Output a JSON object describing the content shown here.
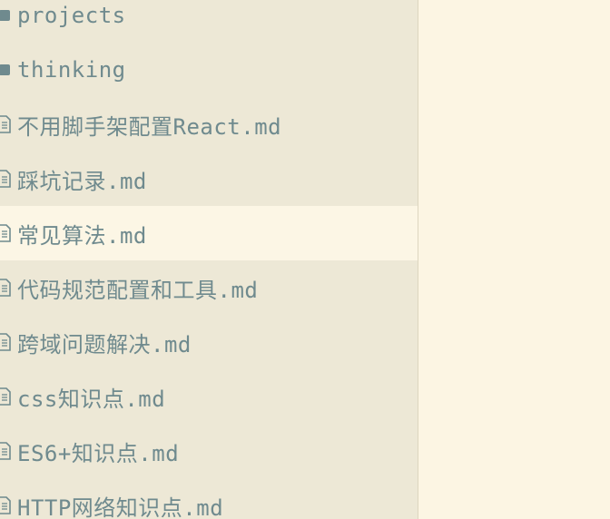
{
  "sidebar": {
    "items": [
      {
        "type": "folder",
        "label": "projects",
        "icon": "folder-icon",
        "selected": false
      },
      {
        "type": "folder",
        "label": "thinking",
        "icon": "folder-icon",
        "selected": false
      },
      {
        "type": "file",
        "label": "不用脚手架配置React.md",
        "icon": "file-icon",
        "selected": false
      },
      {
        "type": "file",
        "label": "踩坑记录.md",
        "icon": "file-icon",
        "selected": false
      },
      {
        "type": "file",
        "label": "常见算法.md",
        "icon": "file-icon",
        "selected": true
      },
      {
        "type": "file",
        "label": "代码规范配置和工具.md",
        "icon": "file-icon",
        "selected": false
      },
      {
        "type": "file",
        "label": "跨域问题解决.md",
        "icon": "file-icon",
        "selected": false
      },
      {
        "type": "file",
        "label": "css知识点.md",
        "icon": "file-icon",
        "selected": false
      },
      {
        "type": "file",
        "label": "ES6+知识点.md",
        "icon": "file-icon",
        "selected": false
      },
      {
        "type": "file",
        "label": "HTTP网络知识点.md",
        "icon": "file-icon",
        "selected": false
      }
    ]
  },
  "colors": {
    "sidebar_bg": "#ede8d6",
    "selected_bg": "#fcf6e5",
    "editor_bg": "#fcf5e3",
    "text": "#6f8a8e",
    "icon": "#6f8a8e"
  }
}
